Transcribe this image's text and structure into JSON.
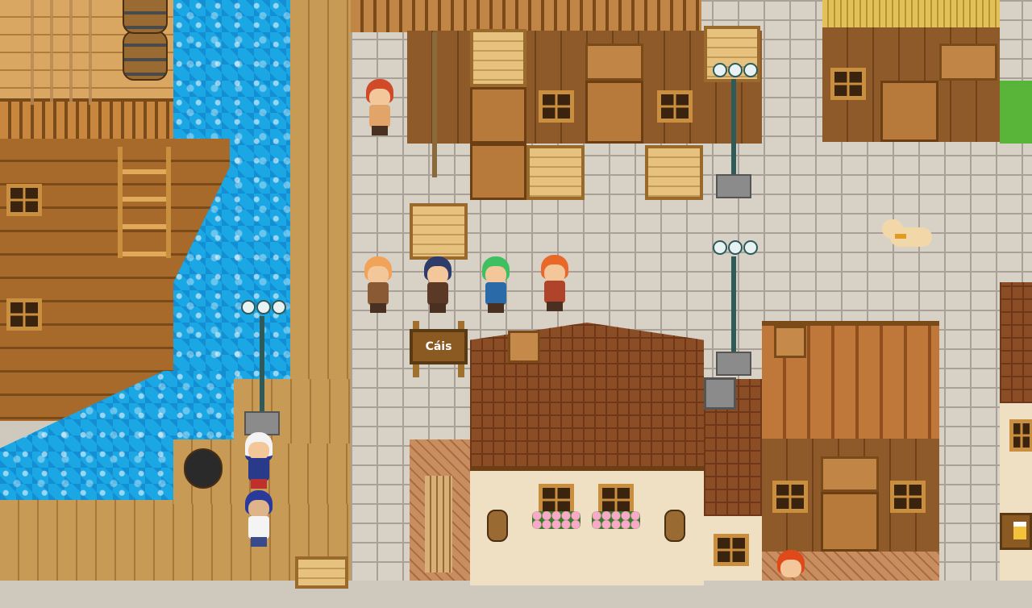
{
  "scene": {
    "title": ""
  },
  "signs": {
    "dock_sign": "Cáis"
  },
  "characters": [
    {
      "name": "red-bandana-sailor-npc"
    },
    {
      "name": "blonde-party-member"
    },
    {
      "name": "dark-haired-party-member"
    },
    {
      "name": "green-haired-party-member"
    },
    {
      "name": "red-haired-party-member"
    },
    {
      "name": "captain-npc"
    },
    {
      "name": "blue-cap-sailor-npc"
    },
    {
      "name": "redhead-villager-npc"
    }
  ],
  "animals": [
    {
      "name": "dog-npc"
    }
  ],
  "icons": {
    "tavern_sign": "beer-mug-icon"
  },
  "colors": {
    "water": "#1aa7e4",
    "cobblestone": "#d7d1c6",
    "roof": "#8b4d26"
  }
}
